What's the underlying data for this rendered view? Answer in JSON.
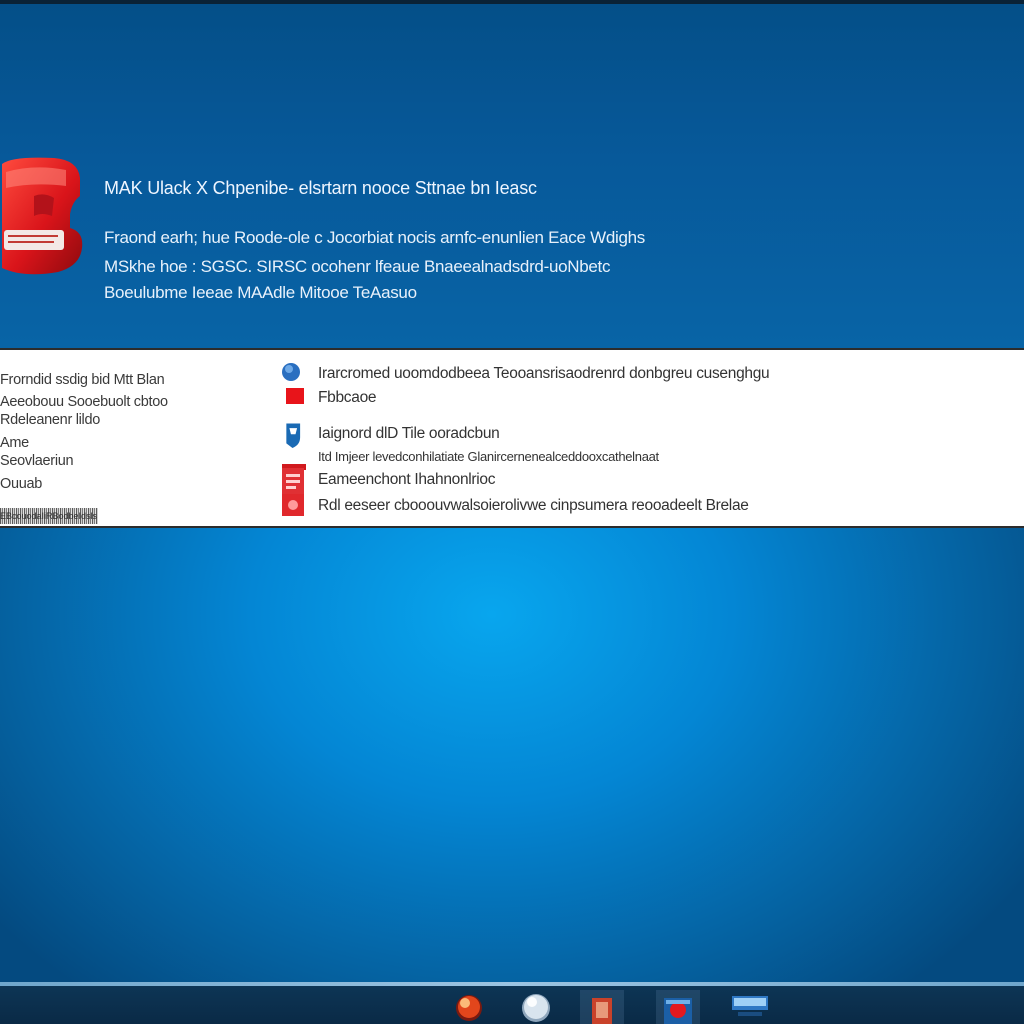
{
  "banner": {
    "title": "MAK Ulack X Chpenibe- elsrtarn nooce Sttnae bn Ieasc",
    "lines": [
      "Fraond earh; hue Roode-ole c Jocorbiat nocis arnfc-enunlien Eace Wdighs",
      "MSkhe hoe  :  SGSC. SIRSC ocohenr  lfeaue  Bnaeealnadsdrd-uoNbetc",
      "Boeulubme Ieeae  MAAdle  Mitooe  TeAasuo"
    ]
  },
  "panel": {
    "left_items": [
      "Frorndid ssdig bid Mtt Blan",
      "Aeeobouu Sooebuolt  cbtoo",
      "Rdeleanenr lildo",
      "Ame",
      "Seovlaeriun",
      "Ouuab"
    ],
    "left_code": "EBcouodaIiRBodbeIdsls",
    "list_items": [
      {
        "label": "Irarcromed uoomdodbeea  Teooansrisaodrenrd donbgreu  cusenghgu",
        "icon": "blue-circle-icon"
      },
      {
        "label": "Fbbcaoe",
        "icon": "red-square-icon"
      },
      {
        "label": "Iaignord dlD Tile ooradcbun",
        "icon": "blue-shield-icon"
      },
      {
        "label": "Itd Imjeer  levedconhilatiate Glanircernenealceddooxcathelnaat",
        "icon": "red-document-icon",
        "small": true
      },
      {
        "label": "Eameenchont   Ihahnonlrioc",
        "icon": "red-document-icon"
      },
      {
        "label": "Rdl eeseer  cbooouvwalsoierolivwe cinpsumera  reooadeelt Brelae",
        "icon": "red-document-icon"
      }
    ]
  },
  "taskbar": {
    "buttons": [
      {
        "name": "taskbar-app-1",
        "icon": "fire-orb-icon"
      },
      {
        "name": "taskbar-app-2",
        "icon": "silver-orb-icon"
      },
      {
        "name": "taskbar-app-3",
        "icon": "red-file-icon"
      },
      {
        "name": "taskbar-app-4",
        "icon": "red-blue-window-icon"
      },
      {
        "name": "taskbar-app-5",
        "icon": "blue-monitor-icon"
      }
    ]
  },
  "colors": {
    "desktop_center": "#08a6ee",
    "desktop_edge": "#044a80",
    "banner": "#07599a",
    "panel": "#ffffff",
    "taskbar": "#0a2a46",
    "error_red": "#e0181c"
  }
}
